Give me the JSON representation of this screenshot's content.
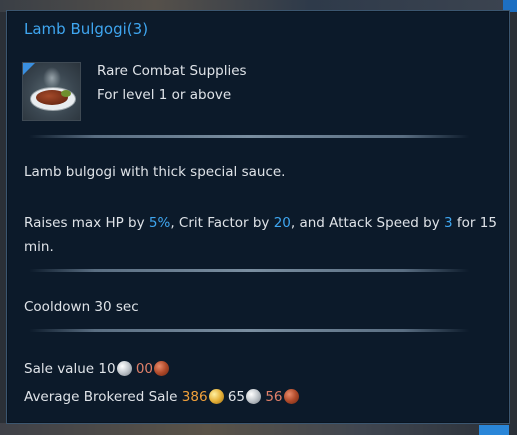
{
  "tooltip": {
    "title": "Lamb Bulgogi(3)",
    "category": "Rare Combat Supplies",
    "level_req": "For level 1 or above",
    "description": "Lamb bulgogi with thick special sauce.",
    "effect": {
      "p1": "Raises max HP by ",
      "hp": "5%",
      "p2": ", Crit Factor by ",
      "crit": "20",
      "p3": ", and Attack Speed by ",
      "speed": "3",
      "p4": " for 15",
      "line2": "min."
    },
    "cooldown": "Cooldown  30 sec",
    "sale": {
      "label": "Sale value ",
      "silver": "10",
      "copper": "00"
    },
    "brokered": {
      "label": "Average Brokered Sale ",
      "gold": "386",
      "silver": "65",
      "copper": "56"
    }
  },
  "icons": {
    "item": "lamb-bulgogi-dish-icon",
    "silver": "silver-coin-icon",
    "copper": "copper-coin-icon",
    "gold": "gold-coin-icon"
  },
  "colors": {
    "highlight": "#3fa6f0",
    "panel_bg": "#0c1a2a",
    "gold_text": "#f0a03a",
    "copper_text": "#e0806a"
  }
}
